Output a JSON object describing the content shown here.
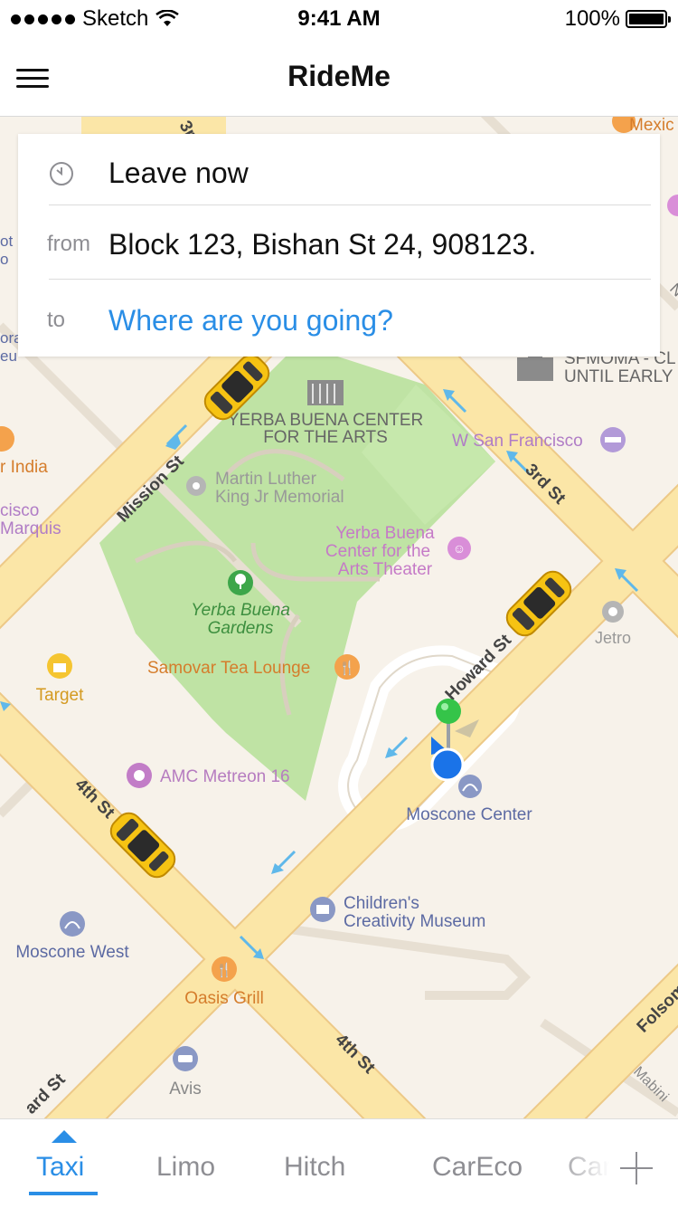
{
  "status_bar": {
    "carrier": "Sketch",
    "time": "9:41 AM",
    "battery": "100%"
  },
  "nav": {
    "title": "RideMe"
  },
  "trip": {
    "leave_value": "Leave now",
    "from_label": "from",
    "from_value": "Block 123, Bishan St 24, 908123.",
    "to_label": "to",
    "to_placeholder": "Where are you going?"
  },
  "map": {
    "labels": {
      "yerba_center": "YERBA BUENA CENTER",
      "yerba_center_2": "FOR THE ARTS",
      "mlk": "Martin Luther",
      "mlk_2": "King Jr Memorial",
      "yb_theater": "Yerba Buena",
      "yb_theater_2": "Center for the",
      "yb_theater_3": "Arts Theater",
      "yb_gardens": "Yerba Buena",
      "yb_gardens_2": "Gardens",
      "samovar": "Samovar Tea Lounge",
      "w_sf": "W San Francisco",
      "sfmoma": "SFMOMA - CL",
      "sfmoma_2": "UNTIL EARLY",
      "jetro": "Jetro",
      "target": "Target",
      "amc": "AMC Metreon 16",
      "moscone_center": "Moscone Center",
      "moscone_west": "Moscone West",
      "childrens": "Children's",
      "childrens_2": "Creativity Museum",
      "oasis": "Oasis Grill",
      "avis": "Avis",
      "india": "r India",
      "cisco": "cisco",
      "marquis": "Marquis",
      "mexic": "Mexic",
      "st_mission": "Mission St",
      "st_3rd_top": "3rd St",
      "st_3rd_top_left": "3r",
      "st_howard": "Howard St",
      "st_4th": "4th St",
      "st_4th_bottom": "4th St",
      "st_folsom": "Folsom",
      "st_mabini": "Mabini",
      "st_howard_bottom": "ard St",
      "edge_ot": "ot",
      "edge_o": "o",
      "edge_ora": "ora",
      "edge_eu": "eu",
      "edge_n": "N"
    },
    "colors": {
      "road": "#fbe6a7",
      "road_edge": "#edc987",
      "park": "#bfe3a4",
      "background": "#f7f2ea",
      "pin_green": "#35c449",
      "user_dot": "#1a73e8",
      "taxi": "#f6c313"
    }
  },
  "tabs": {
    "items": [
      {
        "label": "Taxi",
        "active": true
      },
      {
        "label": "Limo",
        "active": false
      },
      {
        "label": "Hitch",
        "active": false
      },
      {
        "label": "CarEco",
        "active": false
      },
      {
        "label": "Car",
        "active": false
      }
    ],
    "accent_color": "#2a8ee6"
  }
}
